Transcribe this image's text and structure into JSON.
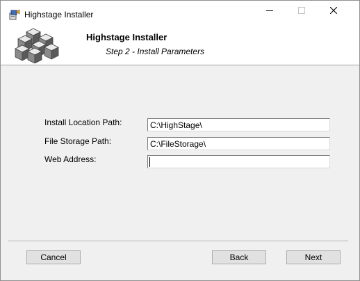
{
  "window": {
    "title": "Highstage Installer",
    "icons": {
      "app": "installer-icon",
      "minimize": "minimize-icon",
      "maximize": "maximize-icon",
      "close": "close-icon"
    }
  },
  "banner": {
    "title": "Highstage Installer",
    "subtitle": "Step 2 - Install Parameters",
    "logo": "cubes-logo"
  },
  "form": {
    "install_location": {
      "label": "Install Location Path:",
      "value": "C:\\HighStage\\"
    },
    "file_storage": {
      "label": "File Storage Path:",
      "value": "C:\\FileStorage\\"
    },
    "web_address": {
      "label": "Web Address:",
      "value": ""
    }
  },
  "buttons": {
    "cancel": "Cancel",
    "back": "Back",
    "next": "Next"
  }
}
